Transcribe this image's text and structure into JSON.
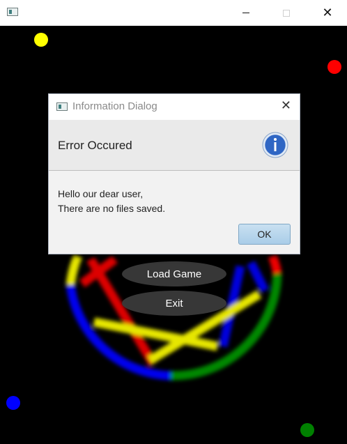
{
  "window": {
    "icon": "app-window-icon",
    "controls": [
      "minimize",
      "maximize",
      "close"
    ]
  },
  "game": {
    "menu": {
      "load_game": "Load Game",
      "exit": "Exit"
    },
    "colors": {
      "yellow": "#ffff00",
      "red": "#ff0000",
      "blue": "#0000ff",
      "green": "#008000"
    }
  },
  "dialog": {
    "title": "Information Dialog",
    "header": "Error Occured",
    "icon": "information-icon",
    "content_lines": [
      "Hello our dear user,",
      "There are no files saved."
    ],
    "ok_label": "OK"
  }
}
